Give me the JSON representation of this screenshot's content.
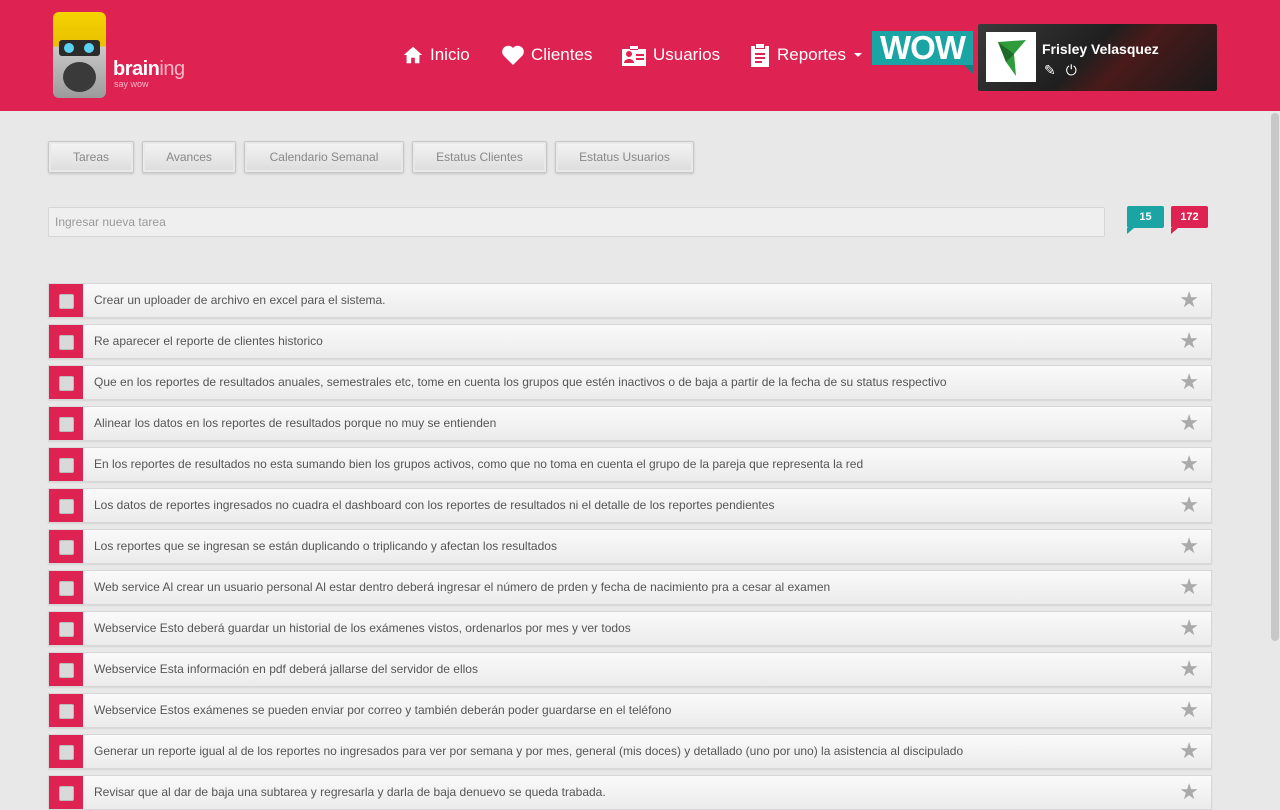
{
  "brand": {
    "name_bold": "brain",
    "name_light": "ing",
    "tagline": "say wow"
  },
  "nav": [
    {
      "label": "Inicio",
      "icon": "home-icon"
    },
    {
      "label": "Clientes",
      "icon": "heart-icon"
    },
    {
      "label": "Usuarios",
      "icon": "id-card-icon"
    },
    {
      "label": "Reportes",
      "icon": "clipboard-icon"
    }
  ],
  "wow": "WOW",
  "user": {
    "name": "Frisley Velasquez",
    "edit_icon": "pencil-icon",
    "logout_icon": "power-icon"
  },
  "tabs": [
    "Tareas",
    "Avances",
    "Calendario Semanal",
    "Estatus Clientes",
    "Estatus Usuarios"
  ],
  "task_input": {
    "placeholder": "Ingresar nueva tarea",
    "value": ""
  },
  "badges": {
    "teal": "15",
    "red": "172"
  },
  "tasks": [
    "Crear un uploader de archivo en excel para el sistema.",
    "Re aparecer el reporte de clientes historico",
    "Que en los reportes de resultados anuales, semestrales etc, tome en cuenta los grupos que estén inactivos o de baja a partir de la fecha de su status respectivo",
    "Alinear los datos en los reportes de resultados porque no muy se entienden",
    "En los reportes de resultados no esta sumando bien los grupos activos, como que no toma en cuenta el grupo de la pareja que representa la red",
    "Los datos de reportes ingresados no cuadra el dashboard con los reportes de resultados ni el detalle de los reportes pendientes",
    "Los reportes que se ingresan se están duplicando o triplicando y afectan los resultados",
    "Web service Al crear un usuario personal Al estar dentro deberá ingresar el número de prden y fecha de nacimiento pra a cesar al examen",
    "Webservice Esto deberá guardar un historial de los exámenes vistos, ordenarlos por mes y ver todos",
    "Webservice Esta información en pdf deberá jallarse del servidor de ellos",
    "Webservice Estos exámenes se pueden enviar por correo y también deberán poder guardarse en el teléfono",
    "Generar un reporte igual al de los reportes no ingresados para ver por semana y por mes, general (mis doces) y detallado (uno por uno) la asistencia al discipulado",
    "Revisar que al dar de baja una subtarea y regresarla y darla de baja denuevo se queda trabada."
  ],
  "colors": {
    "primary": "#de2251",
    "teal": "#1ba4a4",
    "background": "#e8e8e8"
  }
}
